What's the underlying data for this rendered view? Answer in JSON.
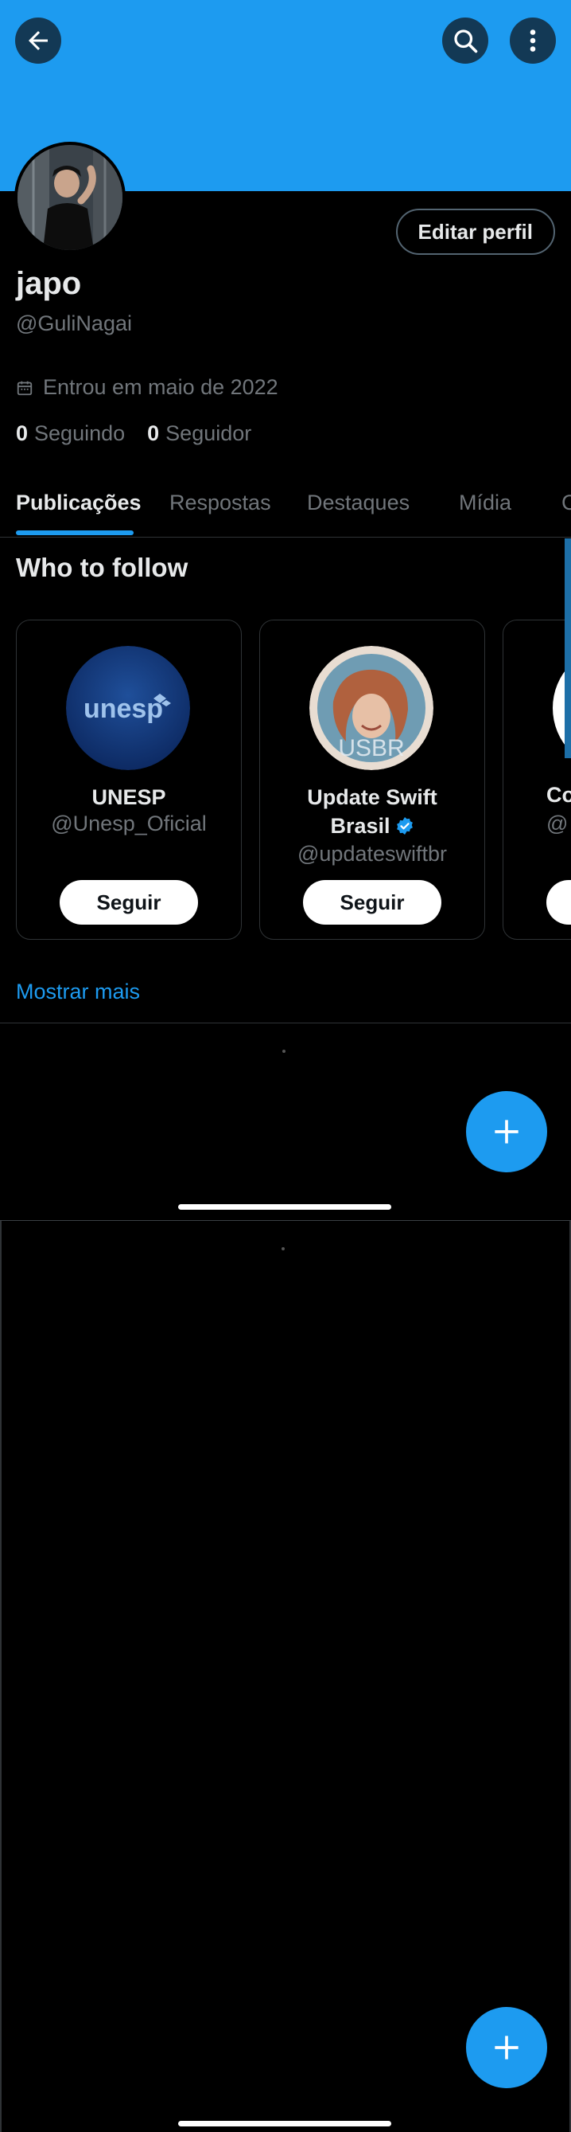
{
  "profile": {
    "name": "japo",
    "handle": "@GuliNagai",
    "joined": "Entrou em maio de 2022",
    "following_count": "0",
    "following_label": "Seguindo",
    "followers_count": "0",
    "followers_label": "Seguidor",
    "edit_label": "Editar perfil"
  },
  "tabs": [
    "Publicações",
    "Respostas",
    "Destaques",
    "Mídia",
    "C"
  ],
  "who_to_follow": {
    "title": "Who to follow",
    "cards": [
      {
        "name": "UNESP",
        "handle": "@Unesp_Oficial",
        "button": "Seguir",
        "avatar_text": "unesp"
      },
      {
        "name_line1": "Update Swift",
        "name_line2": "Brasil",
        "verified": true,
        "handle": "@updateswiftbr",
        "button": "Seguir",
        "avatar_text": "USBR"
      },
      {
        "name_partial": "Co",
        "handle_partial": "@"
      }
    ],
    "show_more": "Mostrar mais"
  },
  "colors": {
    "accent": "#1d9bf0",
    "background": "#000000",
    "secondary_text": "#71767b",
    "border": "#2f3336"
  },
  "icons": {
    "back": "arrow-left-icon",
    "search": "search-icon",
    "more": "more-vertical-icon",
    "calendar": "calendar-icon",
    "compose": "plus-icon",
    "verified": "verified-badge-icon"
  }
}
